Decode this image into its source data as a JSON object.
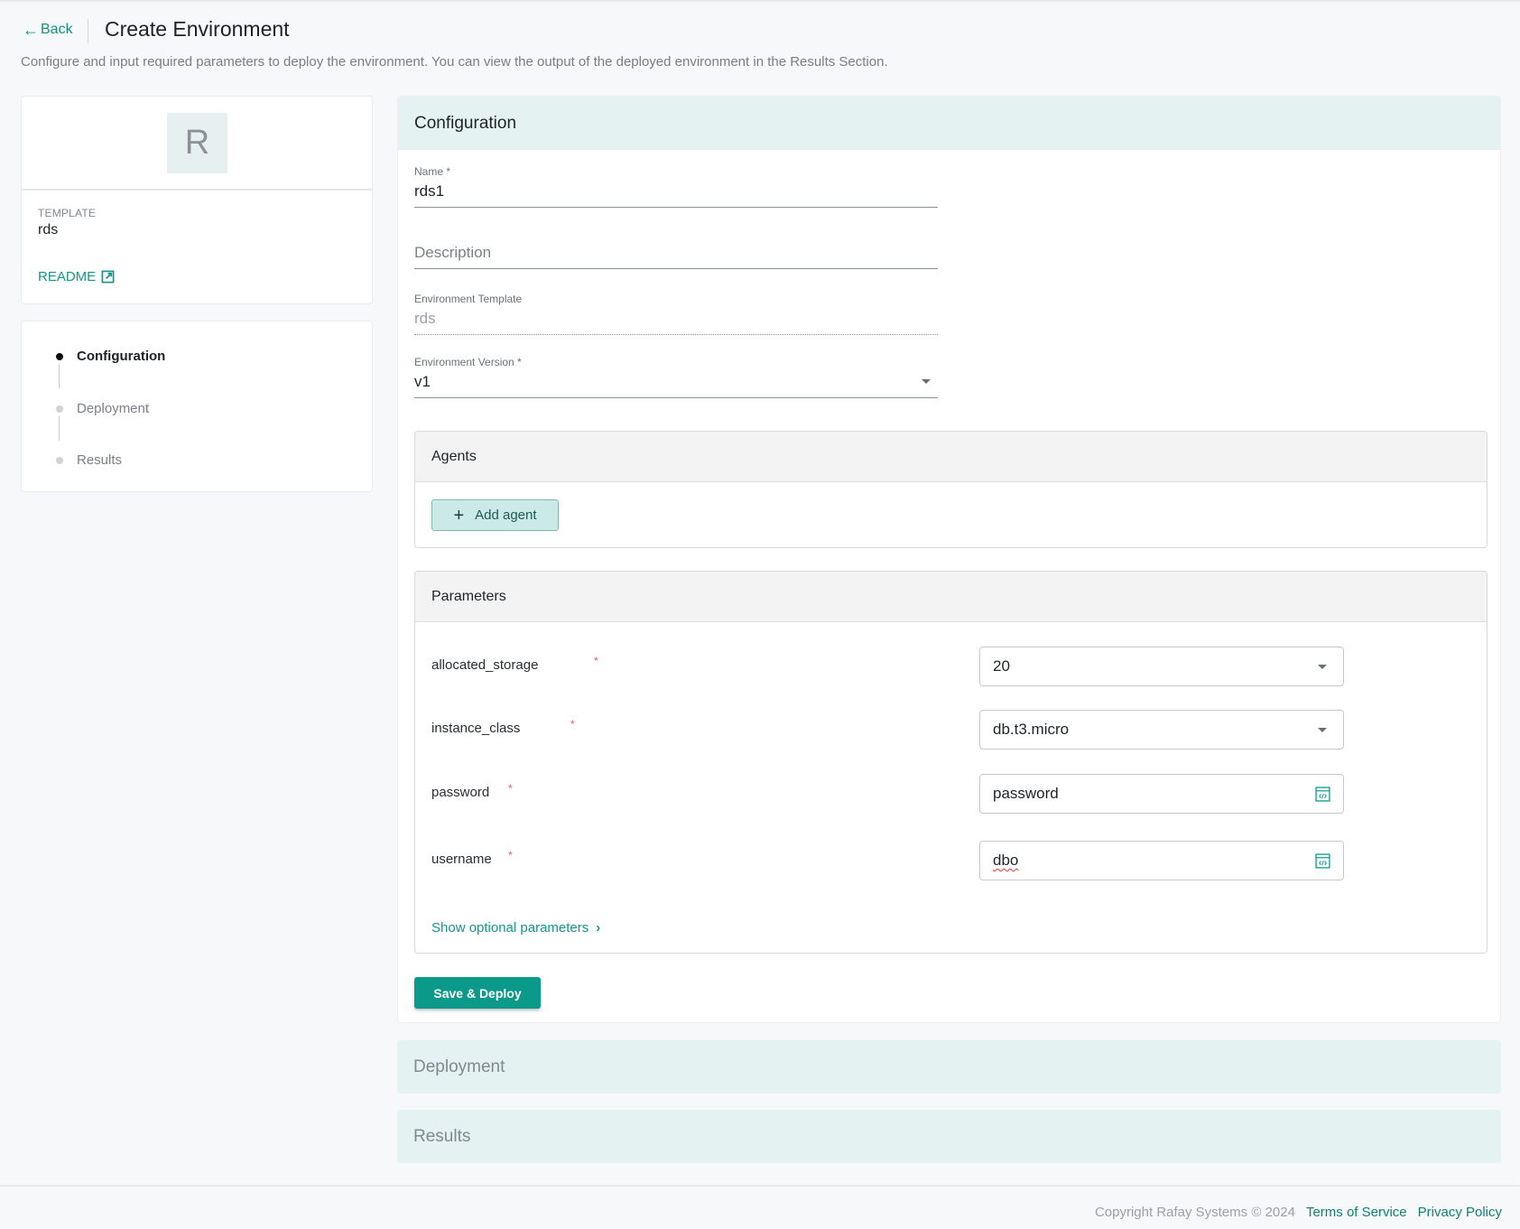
{
  "header": {
    "back_label": "Back",
    "title": "Create Environment",
    "subtitle": "Configure and input required parameters to deploy the environment. You can view the output of the deployed environment in the Results Section."
  },
  "template_card": {
    "avatar_letter": "R",
    "template_label": "TEMPLATE",
    "template_value": "rds",
    "readme_label": "README"
  },
  "steps": [
    {
      "label": "Configuration",
      "active": true
    },
    {
      "label": "Deployment",
      "active": false
    },
    {
      "label": "Results",
      "active": false
    }
  ],
  "configuration": {
    "title": "Configuration",
    "name": {
      "label": "Name *",
      "value": "rds1"
    },
    "description": {
      "placeholder": "Description",
      "value": ""
    },
    "environment_template": {
      "label": "Environment Template",
      "value": "rds"
    },
    "environment_version": {
      "label": "Environment Version *",
      "value": "v1"
    },
    "agents": {
      "title": "Agents",
      "add_button_label": "Add agent"
    },
    "parameters": {
      "title": "Parameters",
      "items": [
        {
          "name": "allocated_storage",
          "required": "*",
          "value": "20",
          "type": "select"
        },
        {
          "name": "instance_class",
          "required": "*",
          "value": "db.t3.micro",
          "type": "select"
        },
        {
          "name": "password",
          "required": "*",
          "value": "password",
          "type": "text"
        },
        {
          "name": "username",
          "required": "*",
          "value": "dbo",
          "type": "text"
        }
      ],
      "show_optional_label": "Show optional parameters"
    },
    "save_button_label": "Save & Deploy"
  },
  "deployment": {
    "title": "Deployment"
  },
  "results": {
    "title": "Results"
  },
  "footer": {
    "copyright": "Copyright Rafay Systems © 2024",
    "terms_label": "Terms of Service",
    "privacy_label": "Privacy Policy"
  },
  "colors": {
    "accent": "#0b9a89",
    "link": "#16978a",
    "panel_header_bg": "#e4f2f1",
    "required": "#e25b5b"
  }
}
